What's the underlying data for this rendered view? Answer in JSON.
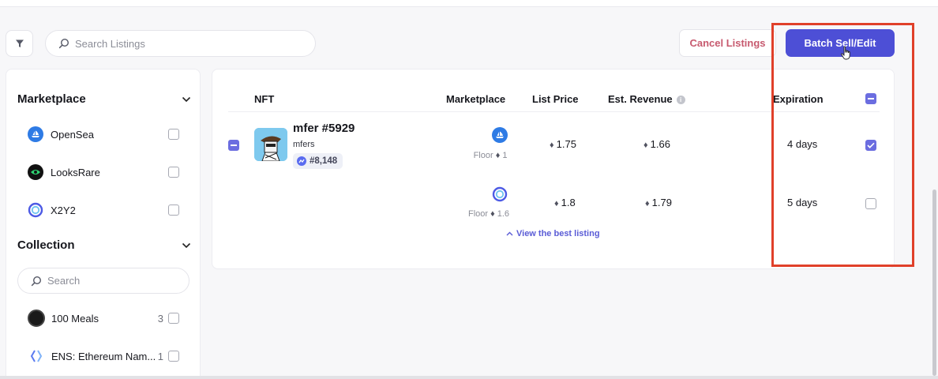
{
  "toolbar": {
    "search_placeholder": "Search Listings",
    "cancel_label": "Cancel Listings",
    "batch_label": "Batch Sell/Edit"
  },
  "sidebar": {
    "marketplace_title": "Marketplace",
    "marketplaces": [
      {
        "label": "OpenSea",
        "icon": "opensea-icon"
      },
      {
        "label": "LooksRare",
        "icon": "looksrare-icon"
      },
      {
        "label": "X2Y2",
        "icon": "x2y2-icon"
      }
    ],
    "collection_title": "Collection",
    "collection_search_placeholder": "Search",
    "collections": [
      {
        "label": "100 Meals",
        "count": "3"
      },
      {
        "label": "ENS: Ethereum Nam...",
        "count": "1"
      }
    ]
  },
  "table": {
    "headers": {
      "nft": "NFT",
      "marketplace": "Marketplace",
      "list_price": "List Price",
      "est_revenue": "Est. Revenue",
      "expiration": "Expiration"
    },
    "nft": {
      "name": "mfer #5929",
      "collection": "mfers",
      "rank": "#8,148"
    },
    "listings": [
      {
        "marketplace": "opensea-icon",
        "floor_label": "Floor",
        "floor_value": "1",
        "price": "1.75",
        "revenue": "1.66",
        "expiration": "4 days",
        "selected": true
      },
      {
        "marketplace": "x2y2-icon",
        "floor_label": "Floor",
        "floor_value": "1.6",
        "price": "1.8",
        "revenue": "1.79",
        "expiration": "5 days",
        "selected": false
      }
    ],
    "view_best_label": "View the best listing"
  },
  "colors": {
    "accent": "#4d4fd6",
    "cancel_text": "#c75a6f",
    "highlight": "#e0402a"
  }
}
